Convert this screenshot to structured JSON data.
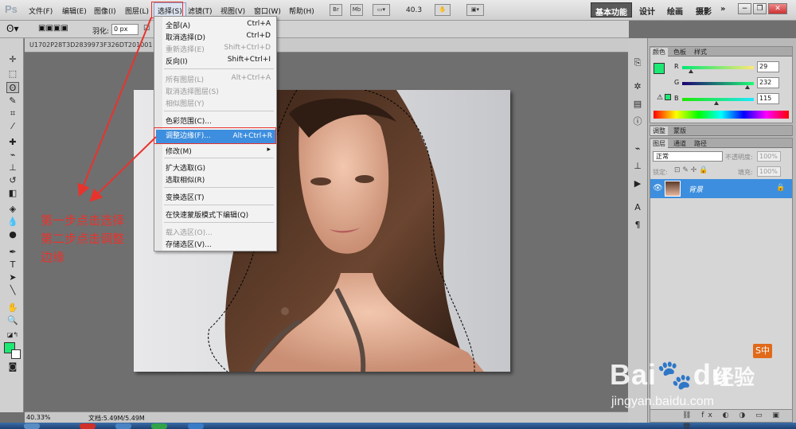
{
  "app": {
    "logo": "Ps"
  },
  "menubar": {
    "items": [
      "文件(F)",
      "编辑(E)",
      "图像(I)",
      "图层(L)",
      "选择(S)",
      "滤镜(T)",
      "视图(V)",
      "窗口(W)",
      "帮助(H)"
    ],
    "active": "选择(S)",
    "zoom": "40.3",
    "bridge_label": "Br",
    "minibridge_label": "Mb"
  },
  "workspaces": {
    "items": [
      "基本功能",
      "设计",
      "绘画",
      "摄影"
    ],
    "active": "基本功能",
    "more": "»"
  },
  "options_bar": {
    "feather_label": "羽化:",
    "feather_value": "0 px"
  },
  "document": {
    "tab_title": "U1702P28T3D2839973F326DT201001"
  },
  "select_menu": {
    "items": [
      {
        "label": "全部(A)",
        "shortcut": "Ctrl+A",
        "enabled": true
      },
      {
        "label": "取消选择(D)",
        "shortcut": "Ctrl+D",
        "enabled": true
      },
      {
        "label": "重新选择(E)",
        "shortcut": "Shift+Ctrl+D",
        "enabled": false
      },
      {
        "label": "反向(I)",
        "shortcut": "Shift+Ctrl+I",
        "enabled": true
      },
      {
        "label": "所有图层(L)",
        "shortcut": "Alt+Ctrl+A",
        "enabled": false
      },
      {
        "label": "取消选择图层(S)",
        "shortcut": "",
        "enabled": false
      },
      {
        "label": "相似图层(Y)",
        "shortcut": "",
        "enabled": false
      },
      {
        "label": "色彩范围(C)...",
        "shortcut": "",
        "enabled": true
      },
      {
        "label": "调整边缘(F)...",
        "shortcut": "Alt+Ctrl+R",
        "enabled": true,
        "highlighted": true
      },
      {
        "label": "修改(M)",
        "shortcut": "▸",
        "enabled": true
      },
      {
        "label": "扩大选取(G)",
        "shortcut": "",
        "enabled": true
      },
      {
        "label": "选取相似(R)",
        "shortcut": "",
        "enabled": true
      },
      {
        "label": "变换选区(T)",
        "shortcut": "",
        "enabled": true
      },
      {
        "label": "在快速蒙版模式下编辑(Q)",
        "shortcut": "",
        "enabled": true
      },
      {
        "label": "载入选区(O)...",
        "shortcut": "",
        "enabled": false
      },
      {
        "label": "存储选区(V)...",
        "shortcut": "",
        "enabled": true
      }
    ]
  },
  "annotation": {
    "line1": "第一步点击选择",
    "line2": "第二步点击调整",
    "line3": "边缘"
  },
  "color_panel": {
    "tabs": [
      "颜色",
      "色板",
      "样式"
    ],
    "r": {
      "label": "R",
      "value": "29"
    },
    "g": {
      "label": "G",
      "value": "232"
    },
    "b": {
      "label": "B",
      "value": "115"
    },
    "foreground_color": "#1de873"
  },
  "adjust_panel": {
    "tabs": [
      "调整",
      "蒙版"
    ]
  },
  "layers_panel": {
    "tabs": [
      "图层",
      "通道",
      "路径"
    ],
    "blend_mode": "正常",
    "opacity_label": "不透明度:",
    "opacity_value": "100%",
    "lock_label": "锁定:",
    "fill_label": "填充:",
    "fill_value": "100%",
    "layer_name": "背景"
  },
  "statusbar": {
    "zoom": "40.33%",
    "doc_info": "文档:5.49M/5.49M"
  },
  "watermark": {
    "logo": "Bai",
    "logo2": "du",
    "cn": "经验",
    "url": "jingyan.baidu.com",
    "badge": "S中"
  }
}
